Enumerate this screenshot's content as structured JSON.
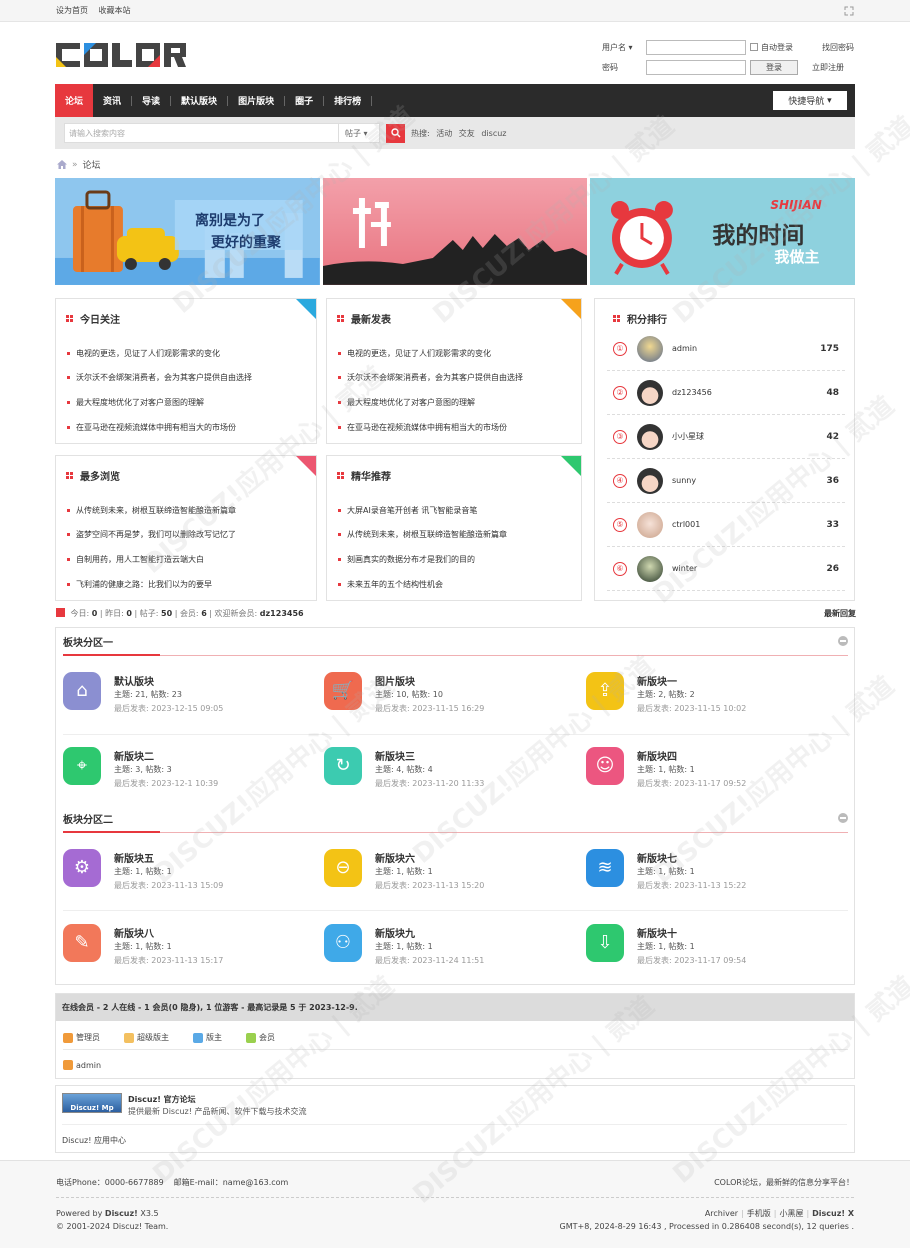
{
  "topbar": {
    "set_home": "设为首页",
    "bookmark": "收藏本站"
  },
  "logo": {
    "text": "COLOR"
  },
  "login": {
    "username_label": "用户名",
    "password_label": "密码",
    "auto_login": "自动登录",
    "forgot": "找回密码",
    "login_btn": "登录",
    "register": "立即注册"
  },
  "nav": {
    "items": [
      "论坛",
      "资讯",
      "导读",
      "默认版块",
      "图片版块",
      "圈子",
      "排行榜"
    ],
    "quick": "快捷导航"
  },
  "search": {
    "placeholder": "请输入搜索内容",
    "type": "帖子",
    "hot_label": "热搜:",
    "hot": [
      "活动",
      "交友",
      "discuz"
    ]
  },
  "breadcrumb": {
    "current": "论坛"
  },
  "banners": {
    "b1_line1": "离别是为了",
    "b1_line2": "更好的重聚",
    "b3_en": "SHIJIAN",
    "b3_line1": "我的时间",
    "b3_line2": "我做主"
  },
  "cards": {
    "today": {
      "title": "今日关注",
      "items": [
        "电视的更迭，见证了人们观影需求的变化",
        "沃尔沃不会绑架消费者，会为其客户提供自由选择",
        "最大程度地优化了对客户意图的理解",
        "在亚马逊在视频流媒体中拥有相当大的市场份"
      ]
    },
    "latest": {
      "title": "最新发表",
      "items": [
        "电视的更迭，见证了人们观影需求的变化",
        "沃尔沃不会绑架消费者，会为其客户提供自由选择",
        "最大程度地优化了对客户意图的理解",
        "在亚马逊在视频流媒体中拥有相当大的市场份"
      ]
    },
    "views": {
      "title": "最多浏览",
      "items": [
        "从传统到未来，树根互联缔造智能酿造新篇章",
        "盗梦空间不再是梦，我们可以删除改写记忆了",
        "自制用药，用人工智能打造云端大白",
        "飞利浦的健康之路：比我们以为的要早"
      ]
    },
    "digest": {
      "title": "精华推荐",
      "items": [
        "大屏AI录音笔开创者 讯飞智能录音笔",
        "从传统到未来，树根互联缔造智能酿造新篇章",
        "刻画真实的数据分布才是我们的目的",
        "未来五年的五个结构性机会"
      ]
    }
  },
  "ranking": {
    "title": "积分排行",
    "rows": [
      {
        "num": "①",
        "name": "admin",
        "score": "175"
      },
      {
        "num": "②",
        "name": "dz123456",
        "score": "48"
      },
      {
        "num": "③",
        "name": "小小星球",
        "score": "42"
      },
      {
        "num": "④",
        "name": "sunny",
        "score": "36"
      },
      {
        "num": "⑤",
        "name": "ctrl001",
        "score": "33"
      },
      {
        "num": "⑥",
        "name": "winter",
        "score": "26"
      }
    ]
  },
  "stats": {
    "today_l": "今日:",
    "today": "0",
    "yesterday_l": "昨日:",
    "yesterday": "0",
    "posts_l": "帖子:",
    "posts": "50",
    "members_l": "会员:",
    "members": "6",
    "new_l": "欢迎新会员:",
    "new_member": "dz123456",
    "latest_reply": "最新回复"
  },
  "forums": {
    "group1": "板块分区一",
    "group2": "板块分区二",
    "items": [
      {
        "name": "默认版块",
        "stats": "主题: 21, 帖数: 23",
        "last": "最后发表: 2023-12-15 09:05",
        "color": "#8b8fd1"
      },
      {
        "name": "图片版块",
        "stats": "主题: 10, 帖数: 10",
        "last": "最后发表: 2023-11-15 16:29",
        "color": "#ef6a4f"
      },
      {
        "name": "新版块一",
        "stats": "主题: 2, 帖数: 2",
        "last": "最后发表: 2023-11-15 10:02",
        "color": "#f3c315"
      },
      {
        "name": "新版块二",
        "stats": "主题: 3, 帖数: 3",
        "last": "最后发表: 2023-12-1 10:39",
        "color": "#2ec86f"
      },
      {
        "name": "新版块三",
        "stats": "主题: 4, 帖数: 4",
        "last": "最后发表: 2023-11-20 11:33",
        "color": "#3ccbb0"
      },
      {
        "name": "新版块四",
        "stats": "主题: 1, 帖数: 1",
        "last": "最后发表: 2023-11-17 09:52",
        "color": "#ec5680"
      },
      {
        "name": "新版块五",
        "stats": "主题: 1, 帖数: 1",
        "last": "最后发表: 2023-11-13 15:09",
        "color": "#a56bd3"
      },
      {
        "name": "新版块六",
        "stats": "主题: 1, 帖数: 1",
        "last": "最后发表: 2023-11-13 15:20",
        "color": "#f3c315"
      },
      {
        "name": "新版块七",
        "stats": "主题: 1, 帖数: 1",
        "last": "最后发表: 2023-11-13 15:22",
        "color": "#2c8fe0"
      },
      {
        "name": "新版块八",
        "stats": "主题: 1, 帖数: 1",
        "last": "最后发表: 2023-11-13 15:17",
        "color": "#f2785a"
      },
      {
        "name": "新版块九",
        "stats": "主题: 1, 帖数: 1",
        "last": "最后发表: 2023-11-24 11:51",
        "color": "#3fa9e8"
      },
      {
        "name": "新版块十",
        "stats": "主题: 1, 帖数: 1",
        "last": "最后发表: 2023-11-17 09:54",
        "color": "#2ec86f"
      }
    ]
  },
  "online": {
    "header": "在线会员 - 2 人在线 - 1 会员(0 隐身), 1 位游客 - 最高记录是 5 于 2023-12-9.",
    "legend": [
      "管理员",
      "超级版主",
      "版主",
      "会员"
    ],
    "users": [
      "admin"
    ]
  },
  "links": {
    "logo_text": "Discuz! Mp",
    "title": "Discuz! 官方论坛",
    "desc": "提供最新 Discuz! 产品新闻、软件下载与技术交流",
    "app": "Discuz! 应用中心"
  },
  "footer": {
    "phone": "电话Phone：0000-6677889",
    "email": "邮箱E-mail：name@163.com",
    "slogan": "COLOR论坛，最新鲜的信息分享平台！",
    "powered_prefix": "Powered by ",
    "powered_name": "Discuz!",
    "powered_ver": " X3.5",
    "copyright": "© 2001-2024 Discuz! Team.",
    "links": [
      "Archiver",
      "手机版",
      "小黑屋",
      "Discuz! X"
    ],
    "runtime": "GMT+8, 2024-8-29 16:43 , Processed in 0.286408 second(s), 12 queries ."
  },
  "watermark": {
    "text": "DISCUZ!应用中心 | 贰道"
  },
  "colors": {
    "accent": "#e7383e",
    "nav_bg": "#2b2b2b"
  }
}
